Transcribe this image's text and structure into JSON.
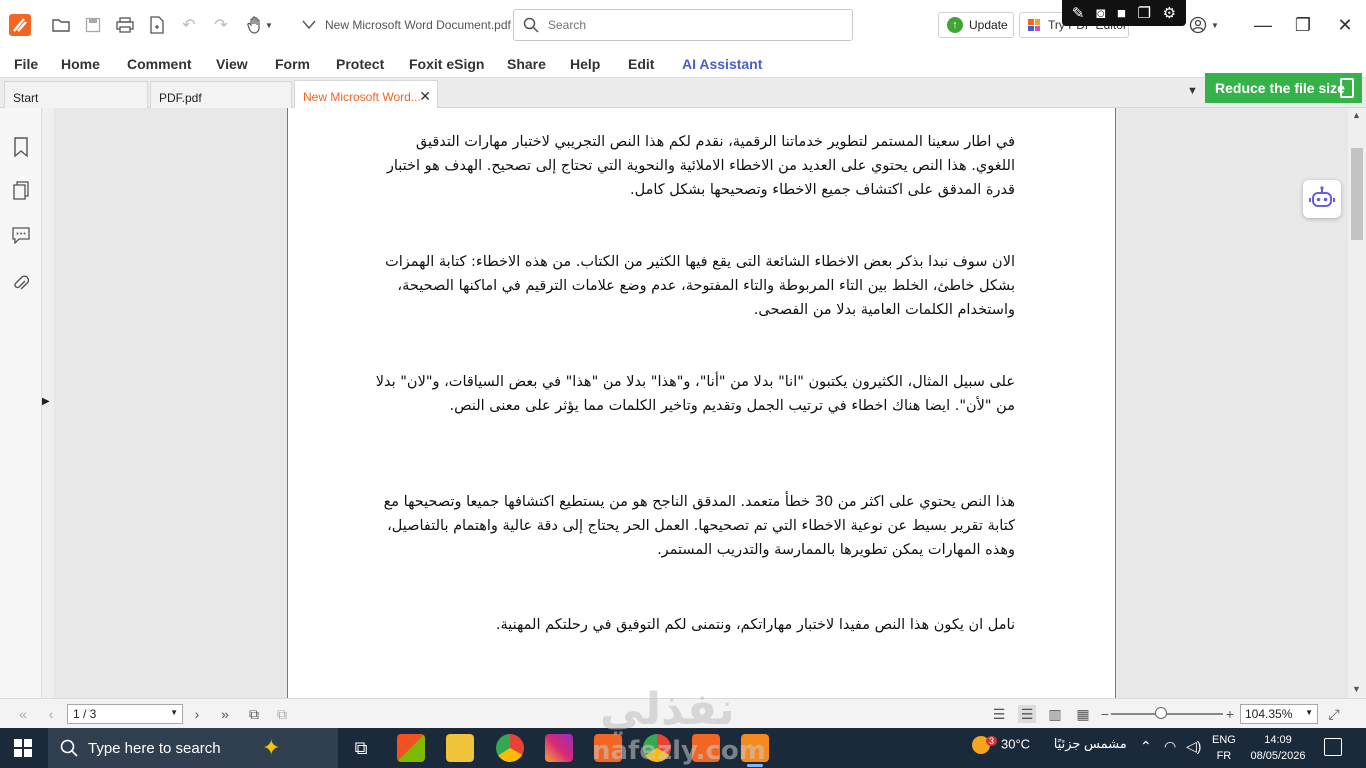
{
  "titlebar": {
    "doc_title": "New Microsoft Word Document.pdf",
    "search_placeholder": "Search",
    "update_label": "Update",
    "try_label": "Try PDF Editor"
  },
  "menu": [
    "File",
    "Home",
    "Comment",
    "View",
    "Form",
    "Protect",
    "Foxit eSign",
    "Share",
    "Help",
    "Edit",
    "AI Assistant"
  ],
  "tabs": [
    {
      "label": "Start"
    },
    {
      "label": "PDF.pdf"
    },
    {
      "label": "New Microsoft Word..."
    }
  ],
  "promo": {
    "label": "Reduce the file size"
  },
  "document": {
    "paragraphs": [
      "في اطار سعينا المستمر لتطوير خدماتنا الرقمية، نقدم لكم هذا النص التجريبي لاختبار مهارات التدقيق اللغوي. هذا النص يحتوي على العديد من الاخطاء الاملائية والنحوية التي تحتاج إلى تصحيح. الهدف هو اختبار قدرة المدقق على اكتشاف جميع الاخطاء وتصحيحها بشكل كامل.",
      "الان سوف نبدا بذكر بعض الاخطاء الشائعة التى يقع فيها الكثير من الكتاب. من هذه الاخطاء: كتابة الهمزات بشكل خاطئ، الخلط بين التاء المربوطة والتاء المفتوحة، عدم وضع علامات الترقيم في اماكنها الصحيحة، واستخدام الكلمات العامية بدلا من الفصحى.",
      "على سبيل المثال، الكثيرون يكتبون \"انا\" بدلا من \"أنا\"، و\"هذا\" بدلا من \"هذا\" في بعض السياقات، و\"لان\" بدلا من \"لأن\". ايضا هناك اخطاء في ترتيب الجمل وتقديم وتاخير الكلمات مما يؤثر على معنى النص.",
      "هذا النص يحتوي على اكثر من 30 خطأ متعمد. المدقق الناجح هو من يستطيع اكتشافها جميعا وتصحيحها مع كتابة تقرير بسيط عن نوعية الاخطاء التي تم تصحيحها. العمل الحر يحتاج إلى دقة عالية واهتمام بالتفاصيل، وهذه المهارات يمكن تطويرها بالممارسة والتدريب المستمر.",
      "نامل ان يكون هذا النص مفيدا لاختبار مهاراتكم، ونتمنى لكم التوفيق في رحلتكم المهنية."
    ]
  },
  "statusbar": {
    "page_indicator": "1 / 3",
    "zoom_value": "104.35%",
    "zoom_level": 0.45
  },
  "taskbar": {
    "search_placeholder": "Type here to search",
    "weather_temp": "30°C",
    "weather_desc": "مشمس جزئيًا",
    "weather_badge": "3",
    "lang_top": "ENG",
    "lang_bottom": "FR",
    "time": "14:09",
    "date": "08/05/2026"
  },
  "watermark": {
    "arabic": "نفذلي",
    "latin": "nafezly.com"
  },
  "colors": {
    "brand": "#f26522",
    "accent": "#4a5ec9",
    "promo": "#35b34a",
    "taskbar": "#1b2a3a"
  }
}
